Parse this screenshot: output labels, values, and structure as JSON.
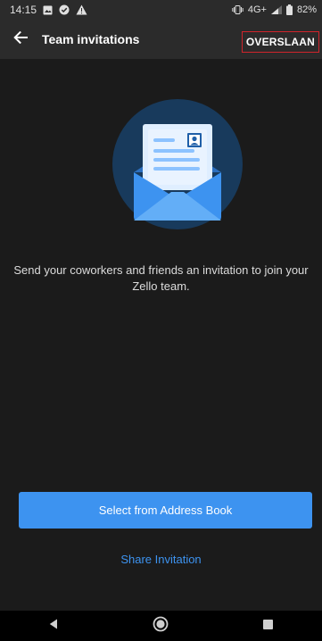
{
  "status_bar": {
    "time": "14:15",
    "network": "4G+",
    "battery": "82%",
    "left_icons": [
      "gallery-icon",
      "check-shield-icon",
      "warning-icon"
    ],
    "right_icons": [
      "vibrate-icon",
      "signal-icon",
      "battery-icon"
    ]
  },
  "app_bar": {
    "title": "Team invitations",
    "skip_label": "OVERSLAAN"
  },
  "main": {
    "message": "Send your coworkers and friends an invitation to join your Zello team.",
    "primary_button": "Select from Address Book",
    "secondary_link": "Share Invitation"
  },
  "nav_bar": {
    "items": [
      "back-triangle-icon",
      "home-circle-icon",
      "recents-square-icon"
    ]
  },
  "colors": {
    "accent": "#3d93f0",
    "background": "#1b1b1b",
    "bar": "#2b2b2b",
    "highlight_border": "#d0242b"
  }
}
